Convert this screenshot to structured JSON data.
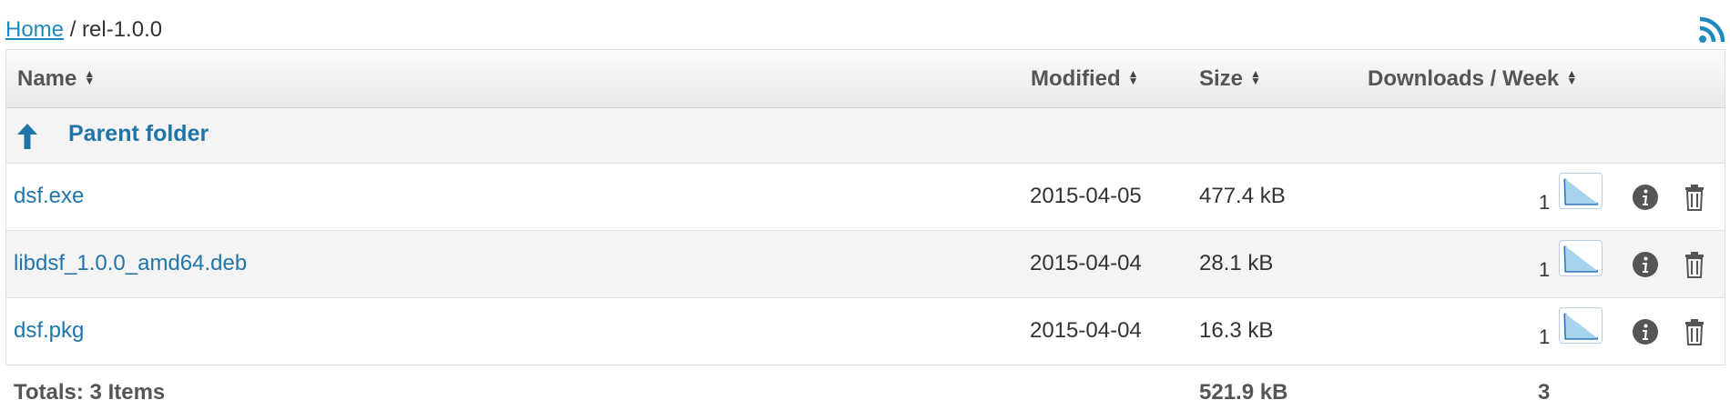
{
  "breadcrumb": {
    "home": "Home",
    "separator": "/",
    "current": "rel-1.0.0"
  },
  "table": {
    "headers": {
      "name": "Name",
      "modified": "Modified",
      "size": "Size",
      "downloads": "Downloads / Week"
    },
    "parent_label": "Parent folder",
    "rows": [
      {
        "name": "dsf.exe",
        "modified": "2015-04-05",
        "size": "477.4 kB",
        "downloads": "1"
      },
      {
        "name": "libdsf_1.0.0_amd64.deb",
        "modified": "2015-04-04",
        "size": "28.1 kB",
        "downloads": "1"
      },
      {
        "name": "dsf.pkg",
        "modified": "2015-04-04",
        "size": "16.3 kB",
        "downloads": "1"
      }
    ],
    "totals": {
      "label": "Totals: 3 Items",
      "size": "521.9 kB",
      "downloads": "3"
    }
  },
  "icons": {
    "rss": "rss-feed-icon",
    "sort": "sort-icon",
    "up": "arrow-up-icon",
    "info": "info-icon",
    "trash": "trash-icon",
    "sparkline": "sparkline-chart"
  },
  "colors": {
    "link": "#1f75a8",
    "accent": "#1f8ac0",
    "header_bg": "#efefef",
    "alt_row": "#f4f4f4"
  }
}
